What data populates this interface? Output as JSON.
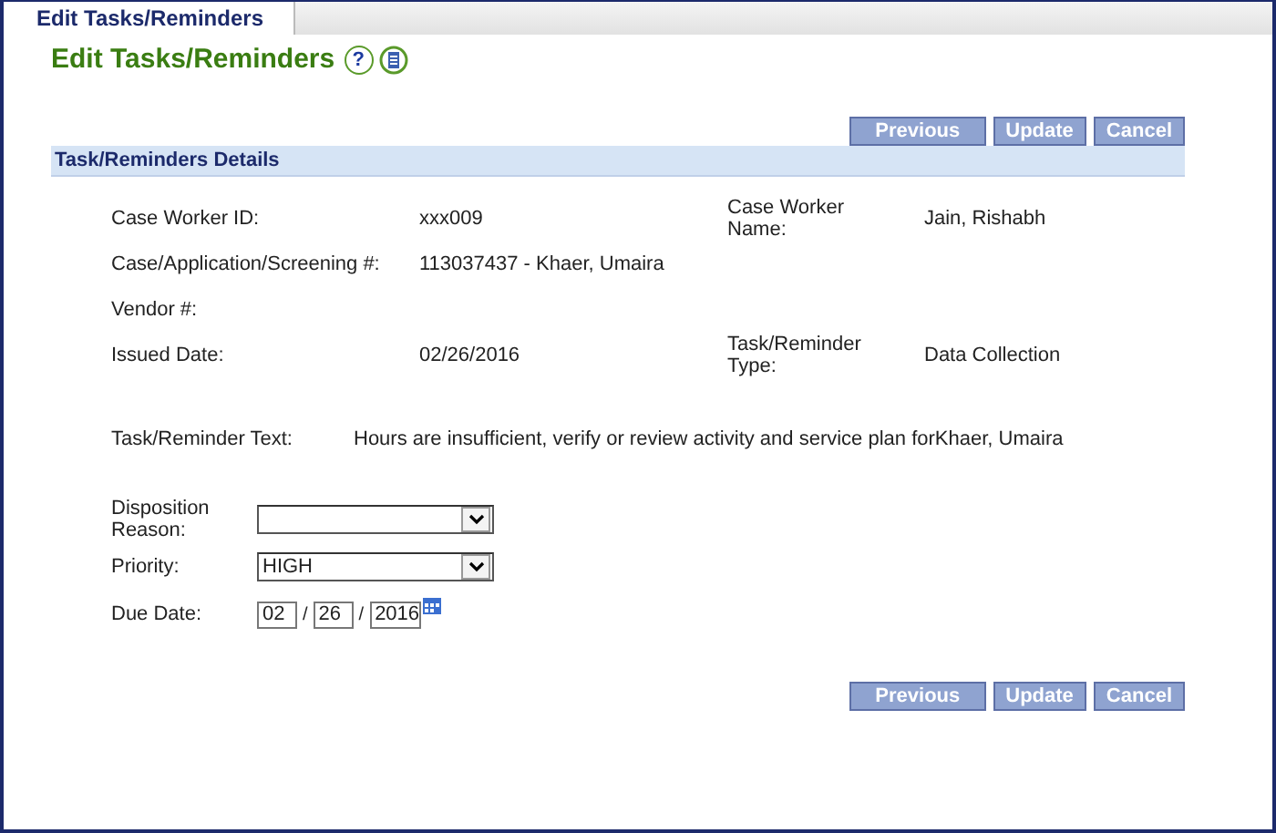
{
  "tabs": [
    {
      "label": "Edit Tasks/Reminders",
      "selected": true
    }
  ],
  "title": "Edit Tasks/Reminders",
  "help_icon": "?",
  "top_buttons": [
    "Previous",
    "Update",
    "Cancel"
  ],
  "section_title": "Task/Reminders Details",
  "detail_rows": [
    {
      "cells": [
        {
          "label": "Case Worker ID:",
          "value": "xxx009"
        },
        {
          "label": "Case Worker Name:",
          "value": "Jain, Rishabh"
        }
      ]
    },
    {
      "cells": [
        {
          "label": "Case/Application/Screening #:",
          "value": "113037437 - Khaer, Umaira"
        }
      ]
    },
    {
      "cells": [
        {
          "label": "Vendor #:"
        }
      ]
    },
    {
      "cells": [
        {
          "label": "Issued Date:",
          "value": "02/26/2016"
        },
        {
          "label": "Task/Reminder Type:",
          "value": "Data Collection"
        }
      ]
    }
  ],
  "task_text": {
    "label": "Task/Reminder Text:",
    "value": "Hours are insufficient, verify or review activity and service plan forKhaer, Umaira"
  },
  "disposition": {
    "label": "Disposition Reason:"
  },
  "priority": {
    "label": "Priority:",
    "value": "HIGH"
  },
  "due_date": {
    "label": "Due Date:",
    "month": "02",
    "separator_1": "/",
    "day": "26",
    "separator_2": "/",
    "year": "2016"
  },
  "bottom_buttons": [
    "Previous",
    "Update",
    "Cancel"
  ]
}
